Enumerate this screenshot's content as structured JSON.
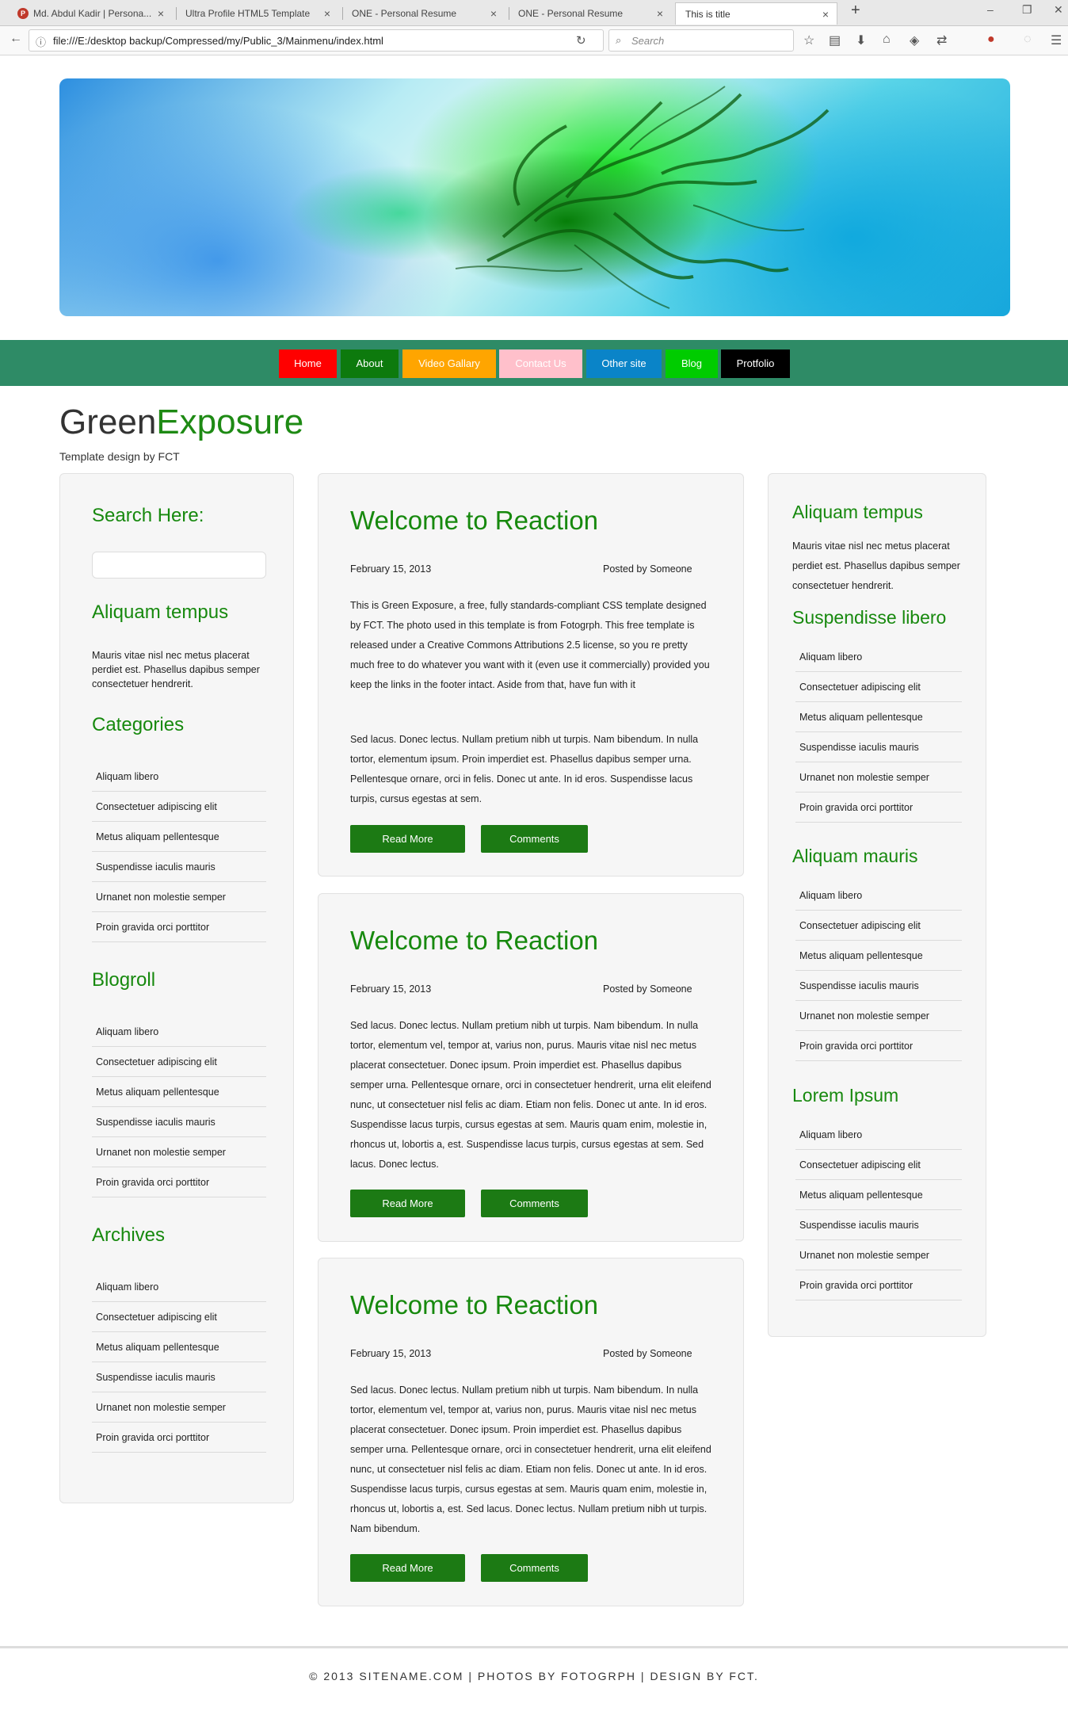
{
  "browser": {
    "tabs": [
      {
        "label": "Md. Abdul Kadir | Persona..."
      },
      {
        "label": "Ultra Profile HTML5 Template"
      },
      {
        "label": "ONE - Personal Resume"
      },
      {
        "label": "ONE - Personal Resume"
      },
      {
        "label": "This is title"
      }
    ],
    "url": "file:///E:/desktop backup/Compressed/my/Public_3/Mainmenu/index.html",
    "search_placeholder": "Search"
  },
  "menu": {
    "items": [
      {
        "label": "Home",
        "color": "#ff0000"
      },
      {
        "label": "About",
        "color": "#0d7a0d"
      },
      {
        "label": "Video Gallary",
        "color": "#ffa500"
      },
      {
        "label": "Contact Us",
        "color": "#ffc0cb"
      },
      {
        "label": "Other site",
        "color": "#0a84c8"
      },
      {
        "label": "Blog",
        "color": "#00cc00"
      },
      {
        "label": "Protfolio",
        "color": "#000000"
      }
    ]
  },
  "site": {
    "title_part1": "Green",
    "title_part2": "Exposure",
    "subtitle": "Template design by FCT"
  },
  "left_sidebar": {
    "search_heading": "Search Here:",
    "aliquam_heading": "Aliquam tempus",
    "aliquam_text": "Mauris vitae nisl nec metus placerat perdiet est. Phasellus dapibus semper consectetuer hendrerit.",
    "categories_heading": "Categories",
    "blogroll_heading": "Blogroll",
    "archives_heading": "Archives",
    "list_items": [
      "Aliquam libero",
      "Consectetuer adipiscing elit",
      "Metus aliquam pellentesque",
      "Suspendisse iaculis mauris",
      "Urnanet non molestie semper",
      "Proin gravida orci porttitor"
    ]
  },
  "posts": [
    {
      "title": "Welcome to Reaction",
      "date": "February 15, 2013",
      "author": "Posted by Someone",
      "para1": "This is Green Exposure, a free, fully standards-compliant CSS template designed by FCT. The photo used in this template is from Fotogrph. This free template is released under a Creative Commons Attributions 2.5 license, so you re pretty much free to do whatever you want with it (even use it commercially) provided you keep the links in the footer intact. Aside from that, have fun with it",
      "para2": "Sed lacus. Donec lectus. Nullam pretium nibh ut turpis. Nam bibendum. In nulla tortor, elementum ipsum. Proin imperdiet est. Phasellus dapibus semper urna. Pellentesque ornare, orci in felis. Donec ut ante. In id eros. Suspendisse lacus turpis, cursus egestas at sem.",
      "read_more": "Read More",
      "comments": "Comments"
    },
    {
      "title": "Welcome to Reaction",
      "date": "February 15, 2013",
      "author": "Posted by Someone",
      "para1": "Sed lacus. Donec lectus. Nullam pretium nibh ut turpis. Nam bibendum. In nulla tortor, elementum vel, tempor at, varius non, purus. Mauris vitae nisl nec metus placerat consectetuer. Donec ipsum. Proin imperdiet est. Phasellus dapibus semper urna. Pellentesque ornare, orci in consectetuer hendrerit, urna elit eleifend nunc, ut consectetuer nisl felis ac diam. Etiam non felis. Donec ut ante. In id eros. Suspendisse lacus turpis, cursus egestas at sem. Mauris quam enim, molestie in, rhoncus ut, lobortis a, est. Suspendisse lacus turpis, cursus egestas at sem. Sed lacus. Donec lectus.",
      "read_more": "Read More",
      "comments": "Comments"
    },
    {
      "title": "Welcome to Reaction",
      "date": "February 15, 2013",
      "author": "Posted by Someone",
      "para1": "Sed lacus. Donec lectus. Nullam pretium nibh ut turpis. Nam bibendum. In nulla tortor, elementum vel, tempor at, varius non, purus. Mauris vitae nisl nec metus placerat consectetuer. Donec ipsum. Proin imperdiet est. Phasellus dapibus semper urna. Pellentesque ornare, orci in consectetuer hendrerit, urna elit eleifend nunc, ut consectetuer nisl felis ac diam. Etiam non felis. Donec ut ante. In id eros. Suspendisse lacus turpis, cursus egestas at sem. Mauris quam enim, molestie in, rhoncus ut, lobortis a, est. Sed lacus. Donec lectus. Nullam pretium nibh ut turpis. Nam bibendum.",
      "read_more": "Read More",
      "comments": "Comments"
    }
  ],
  "right_sidebar": {
    "aliquam_heading": "Aliquam tempus",
    "aliquam_text": "Mauris vitae nisl nec metus placerat perdiet est. Phasellus dapibus semper consectetuer hendrerit.",
    "suspendisse_heading": "Suspendisse libero",
    "mauris_heading": "Aliquam mauris",
    "lorem_heading": "Lorem Ipsum",
    "list_items": [
      "Aliquam libero",
      "Consectetuer adipiscing elit",
      "Metus aliquam pellentesque",
      "Suspendisse iaculis mauris",
      "Urnanet non molestie semper",
      "Proin gravida orci porttitor"
    ]
  },
  "footer": {
    "text": "© 2013 SITENAME.COM | PHOTOS BY FOTOGRPH | DESIGN BY FCT."
  }
}
